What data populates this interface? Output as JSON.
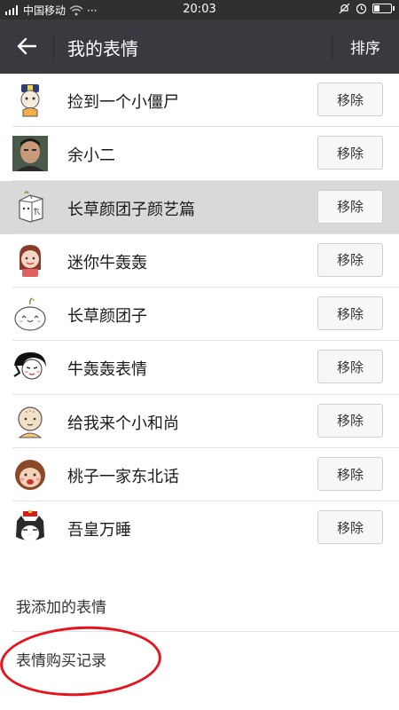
{
  "status_bar": {
    "carrier": "中国移动",
    "time": "20:03",
    "dots": "···"
  },
  "header": {
    "title": "我的表情",
    "sort_label": "排序"
  },
  "stickers": [
    {
      "name": "捡到一个小僵尸",
      "remove_label": "移除",
      "icon": "jiangshi-icon"
    },
    {
      "name": "余小二",
      "remove_label": "移除",
      "icon": "photo-avatar-icon"
    },
    {
      "name": "长草颜团子颜艺篇",
      "remove_label": "移除",
      "icon": "box-face-icon"
    },
    {
      "name": "迷你牛轰轰",
      "remove_label": "移除",
      "icon": "mini-niu-icon"
    },
    {
      "name": "长草颜团子",
      "remove_label": "移除",
      "icon": "dumpling-icon"
    },
    {
      "name": "牛轰轰表情",
      "remove_label": "移除",
      "icon": "black-hair-face-icon"
    },
    {
      "name": "给我来个小和尚",
      "remove_label": "移除",
      "icon": "monk-icon"
    },
    {
      "name": "桃子一家东北话",
      "remove_label": "移除",
      "icon": "monkey-face-icon"
    },
    {
      "name": "吾皇万睡",
      "remove_label": "移除",
      "icon": "cat-icon"
    }
  ],
  "footer": {
    "added_label": "我添加的表情",
    "purchase_label": "表情购买记录"
  },
  "colors": {
    "title_bar": "#393a3f",
    "status_bar": "#303030",
    "highlight_row": "#d9d9d9",
    "annotation": "#e8121a"
  }
}
